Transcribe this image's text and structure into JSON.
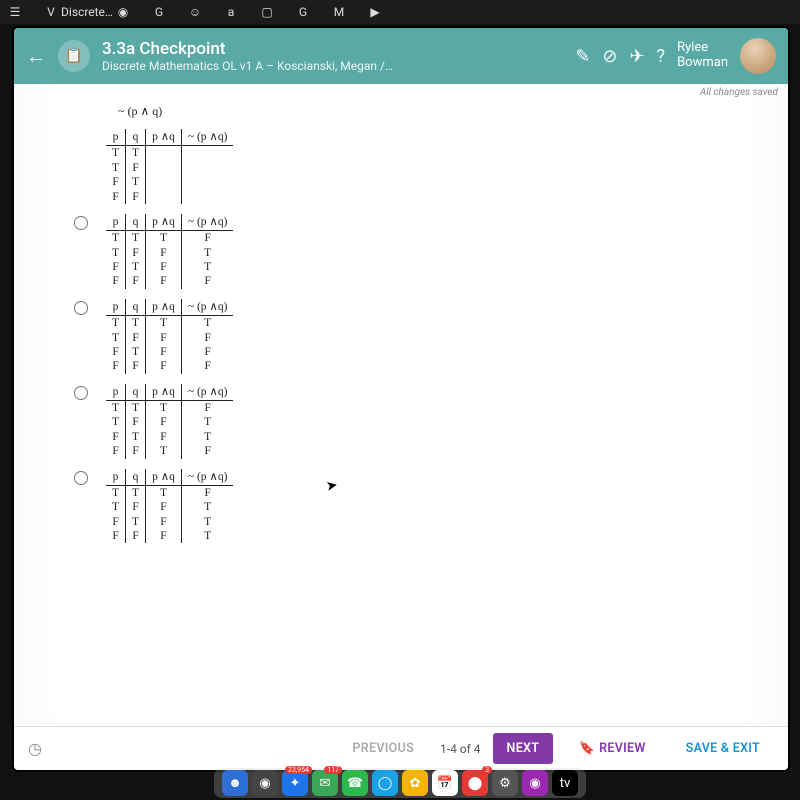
{
  "menubar": {
    "items": [
      "☰",
      "V",
      "Discrete…",
      "◉",
      "G",
      "☺",
      "a",
      "▢",
      "G",
      "M",
      "▶"
    ]
  },
  "header": {
    "title": "3.3a Checkpoint",
    "subtitle": "Discrete Mathematics OL v1 A – Koscianski, Megan /…",
    "username": "Rylee\nBowman"
  },
  "status": "All changes saved",
  "expression": "~ (p ∧ q)",
  "tables": [
    {
      "headers": [
        "p",
        "q",
        "p ∧q",
        "~ (p ∧q)"
      ],
      "rows": [
        [
          "T",
          "T",
          "",
          ""
        ],
        [
          "T",
          "F",
          "",
          ""
        ],
        [
          "F",
          "T",
          "",
          ""
        ],
        [
          "F",
          "F",
          "",
          ""
        ]
      ]
    },
    {
      "headers": [
        "p",
        "q",
        "p ∧q",
        "~ (p ∧q)"
      ],
      "rows": [
        [
          "T",
          "T",
          "T",
          "F"
        ],
        [
          "T",
          "F",
          "F",
          "T"
        ],
        [
          "F",
          "T",
          "F",
          "T"
        ],
        [
          "F",
          "F",
          "F",
          "F"
        ]
      ]
    },
    {
      "headers": [
        "p",
        "q",
        "p ∧q",
        "~ (p ∧q)"
      ],
      "rows": [
        [
          "T",
          "T",
          "T",
          "T"
        ],
        [
          "T",
          "F",
          "F",
          "F"
        ],
        [
          "F",
          "T",
          "F",
          "F"
        ],
        [
          "F",
          "F",
          "F",
          "F"
        ]
      ]
    },
    {
      "headers": [
        "p",
        "q",
        "p ∧q",
        "~ (p ∧q)"
      ],
      "rows": [
        [
          "T",
          "T",
          "T",
          "F"
        ],
        [
          "T",
          "F",
          "F",
          "T"
        ],
        [
          "F",
          "T",
          "F",
          "T"
        ],
        [
          "F",
          "F",
          "T",
          "F"
        ]
      ]
    },
    {
      "headers": [
        "p",
        "q",
        "p ∧q",
        "~ (p ∧q)"
      ],
      "rows": [
        [
          "T",
          "T",
          "T",
          "F"
        ],
        [
          "T",
          "F",
          "F",
          "T"
        ],
        [
          "F",
          "T",
          "F",
          "T"
        ],
        [
          "F",
          "F",
          "F",
          "T"
        ]
      ]
    }
  ],
  "footer": {
    "previous": "PREVIOUS",
    "indicator": "1-4 of 4",
    "next": "NEXT",
    "review": "REVIEW",
    "save_exit": "SAVE & EXIT"
  },
  "dock": {
    "apps": [
      {
        "color": "#2e6fd6",
        "glyph": "☻"
      },
      {
        "color": "#444",
        "glyph": "◉"
      },
      {
        "color": "#1e73e8",
        "glyph": "✦",
        "badge": "23,954"
      },
      {
        "color": "#3aa757",
        "glyph": "✉",
        "badge": "117"
      },
      {
        "color": "#2db84d",
        "glyph": "☎"
      },
      {
        "color": "#1aa2e6",
        "glyph": "◯"
      },
      {
        "color": "#f4b400",
        "glyph": "✿"
      },
      {
        "color": "#fff",
        "glyph": "📅"
      },
      {
        "color": "#e53935",
        "glyph": "⬤",
        "badge": "3"
      },
      {
        "color": "#555",
        "glyph": "⚙"
      },
      {
        "color": "#9c27b0",
        "glyph": "◉"
      },
      {
        "color": "#000",
        "glyph": "tv"
      }
    ]
  }
}
